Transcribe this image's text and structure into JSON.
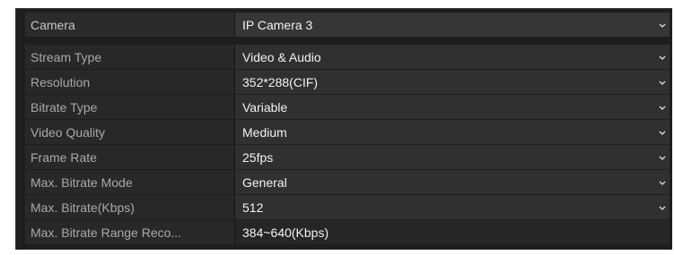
{
  "settings": {
    "rows": [
      {
        "label": "Camera",
        "value": "IP Camera 3"
      },
      {
        "label": "Stream Type",
        "value": "Video & Audio"
      },
      {
        "label": "Resolution",
        "value": "352*288(CIF)"
      },
      {
        "label": "Bitrate Type",
        "value": "Variable"
      },
      {
        "label": "Video Quality",
        "value": "Medium"
      },
      {
        "label": "Frame Rate",
        "value": "25fps"
      },
      {
        "label": "Max. Bitrate Mode",
        "value": "General"
      },
      {
        "label": "Max. Bitrate(Kbps)",
        "value": "512"
      },
      {
        "label": "Max. Bitrate Range Reco...",
        "value": "384~640(Kbps)"
      }
    ]
  },
  "icons": {
    "dropdown": "chevron-down-icon"
  },
  "colors": {
    "panel_bg": "#1e1e1e",
    "label_text": "#a9a9a9",
    "value_text": "#f2f2f2"
  }
}
